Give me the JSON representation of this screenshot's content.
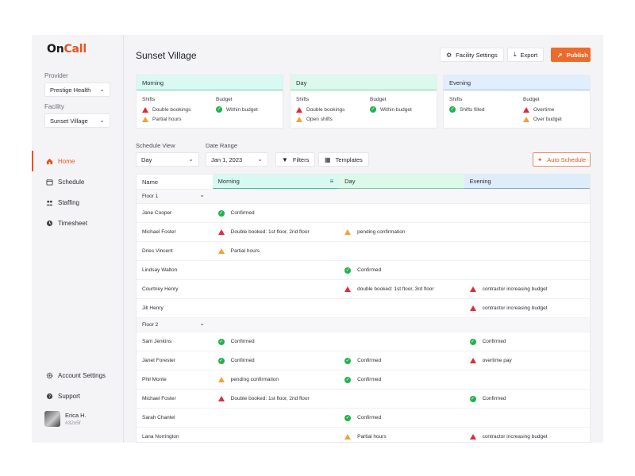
{
  "brand": {
    "on": "On",
    "call": "Call"
  },
  "sidebar": {
    "provider_label": "Provider",
    "provider_value": "Prestige Health",
    "facility_label": "Facility",
    "facility_value": "Sunset Village",
    "nav": [
      {
        "label": "Home",
        "active": true,
        "icon": "home-icon"
      },
      {
        "label": "Schedule",
        "active": false,
        "icon": "calendar-icon"
      },
      {
        "label": "Staffing",
        "active": false,
        "icon": "people-icon"
      },
      {
        "label": "Timesheet",
        "active": false,
        "icon": "clock-icon"
      }
    ],
    "account_settings": "Account Settings",
    "support": "Support",
    "user": {
      "name": "Erica H.",
      "id": "#32x5f"
    }
  },
  "header": {
    "title": "Sunset Village",
    "facility_settings": "Facility Settings",
    "export": "Export",
    "publish": "Publish"
  },
  "summary": [
    {
      "title": "Morning",
      "shifts_label": "Shifts",
      "budget_label": "Budget",
      "shifts": [
        {
          "status": "error",
          "text": "Double bookings"
        },
        {
          "status": "warning",
          "text": "Partial hours"
        }
      ],
      "budget": [
        {
          "status": "ok",
          "text": "Within budget"
        }
      ]
    },
    {
      "title": "Day",
      "shifts_label": "Shifts",
      "budget_label": "Budget",
      "shifts": [
        {
          "status": "error",
          "text": "Double bookings"
        },
        {
          "status": "warning",
          "text": "Open shifts"
        }
      ],
      "budget": [
        {
          "status": "ok",
          "text": "Within budget"
        }
      ]
    },
    {
      "title": "Evening",
      "shifts_label": "Shifts",
      "budget_label": "Budget",
      "shifts": [
        {
          "status": "ok",
          "text": "Shifts filled"
        }
      ],
      "budget": [
        {
          "status": "error",
          "text": "Overtime"
        },
        {
          "status": "warning",
          "text": "Over budget"
        }
      ]
    }
  ],
  "controls": {
    "schedule_view_label": "Schedule View",
    "schedule_view_value": "Day",
    "date_range_label": "Date Range",
    "date_range_value": "Jan 1, 2023",
    "filters": "Filters",
    "templates": "Templates",
    "auto_schedule": "Auto Schedule"
  },
  "table": {
    "columns": {
      "name": "Name",
      "morning": "Morning",
      "day": "Day",
      "evening": "Evening"
    },
    "groups": [
      {
        "name": "Floor 1",
        "rows": [
          {
            "name": "Jane Cooper",
            "morning": {
              "status": "ok",
              "text": "Confirmed"
            },
            "day": null,
            "evening": null
          },
          {
            "name": "Michael Foster",
            "morning": {
              "status": "error",
              "text": "Double booked: 1st floor, 2nd floor"
            },
            "day": {
              "status": "warning",
              "text": "pending confirmation"
            },
            "evening": null
          },
          {
            "name": "Dries Vincent",
            "morning": {
              "status": "warning",
              "text": "Partial hours"
            },
            "day": null,
            "evening": null
          },
          {
            "name": "Lindsay Walton",
            "morning": null,
            "day": {
              "status": "ok",
              "text": "Confirmed"
            },
            "evening": null
          },
          {
            "name": "Courtney Henry",
            "morning": null,
            "day": {
              "status": "error",
              "text": "double booked: 1st floor, 3rd floor"
            },
            "evening": {
              "status": "error",
              "text": "contractor increasing budget"
            }
          },
          {
            "name": "Jill Henry",
            "morning": null,
            "day": null,
            "evening": {
              "status": "error",
              "text": "contractor increasing budget"
            }
          }
        ]
      },
      {
        "name": "Floor 2",
        "rows": [
          {
            "name": "Sam Jenkins",
            "morning": {
              "status": "ok",
              "text": "Confirmed"
            },
            "day": null,
            "evening": {
              "status": "ok",
              "text": "Confirmed"
            }
          },
          {
            "name": "Janet Forester",
            "morning": {
              "status": "ok",
              "text": "Confirmed"
            },
            "day": {
              "status": "ok",
              "text": "Confirmed"
            },
            "evening": {
              "status": "error",
              "text": "overtime pay"
            }
          },
          {
            "name": "Phil Monte",
            "morning": {
              "status": "warning",
              "text": "pending confirmation"
            },
            "day": {
              "status": "ok",
              "text": "Confirmed"
            },
            "evening": null
          },
          {
            "name": "Michael Foster",
            "morning": {
              "status": "error",
              "text": "Double booked: 1st floor, 2nd floor"
            },
            "day": null,
            "evening": {
              "status": "ok",
              "text": "Confirmed"
            }
          },
          {
            "name": "Sarah Chantel",
            "morning": null,
            "day": {
              "status": "ok",
              "text": "Confirmed"
            },
            "evening": null
          },
          {
            "name": "Lana Norrington",
            "morning": null,
            "day": {
              "status": "warning",
              "text": "Partial hours"
            },
            "evening": {
              "status": "error",
              "text": "contractor increasing budget"
            }
          }
        ]
      }
    ]
  },
  "colors": {
    "accent": "#e8531e",
    "ok": "#22b24c",
    "error": "#e02a3a",
    "warning": "#f1a33a"
  }
}
